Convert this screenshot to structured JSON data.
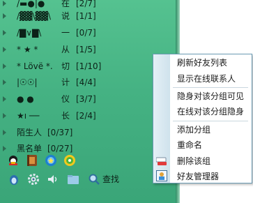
{
  "groups": [
    {
      "name": "/▬●|●",
      "label": "在",
      "count": "[2/7]"
    },
    {
      "name": "/▓▓\\▓▓\\",
      "label": "说",
      "count": "[1/1]"
    },
    {
      "name": "/▇∨▇\\",
      "label": "一",
      "count": "[0/7]"
    },
    {
      "name": "*     ★ *",
      "label": "从",
      "count": "[1/5]"
    },
    {
      "name": "* Lövë *.",
      "label": "切",
      "count": "[1/10]"
    },
    {
      "name": "|☉☉|",
      "label": "计",
      "count": "[4/4]"
    },
    {
      "name": "●     ●",
      "label": "仪",
      "count": "[3/7]"
    },
    {
      "name": "★ı ──",
      "label": "长",
      "count": "[2/4]"
    },
    {
      "name": "陌生人",
      "label": "",
      "count": "[0/37]"
    },
    {
      "name": "黑名单",
      "label": "",
      "count": "[0/27]"
    }
  ],
  "toolbar": {
    "find_label": "查找",
    "top_icons": [
      "qq-logo-icon",
      "address-book-icon",
      "qq-zone-icon",
      "music-icon"
    ],
    "bottom_icons": [
      "penguin-icon",
      "settings-gear-icon",
      "volume-icon",
      "folder-icon",
      "search-icon"
    ]
  },
  "menu": {
    "sections": [
      [
        "刷新好友列表",
        "显示在线联系人"
      ],
      [
        "隐身对该分组可见",
        "在线对该分组隐身"
      ],
      [
        "添加分组",
        "重命名",
        "删除该组",
        "好友管理器"
      ]
    ],
    "item_icons": {
      "删除该组": "delete-group-icon",
      "好友管理器": "friend-manager-icon"
    }
  },
  "colors": {
    "panel_green": "#45b283",
    "menu_border": "#6b9bb3",
    "menu_strip": "#dbeaf2"
  }
}
